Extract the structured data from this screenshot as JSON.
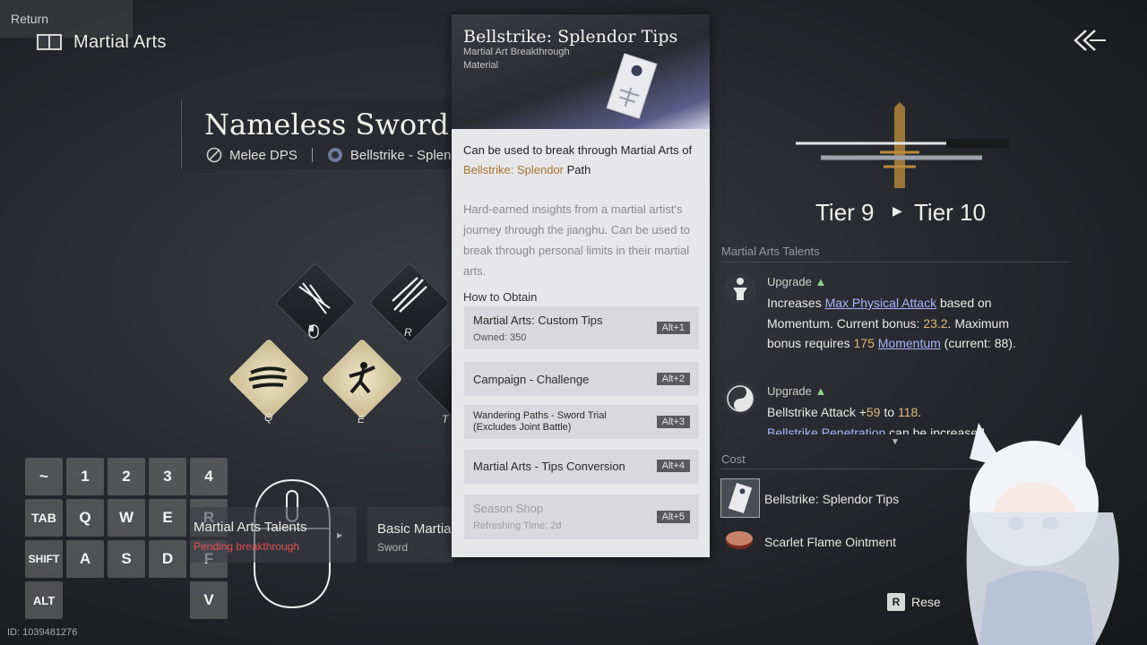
{
  "header": {
    "title": "Martial Arts"
  },
  "character": {
    "name": "Nameless Sword",
    "role": "Melee DPS",
    "path": "Bellstrike - Splendor"
  },
  "skills": {
    "keys": [
      "R",
      "Q",
      "E",
      "T"
    ]
  },
  "keyboard": {
    "row1": [
      "~",
      "1",
      "2",
      "3",
      "4"
    ],
    "row2": [
      "TAB",
      "Q",
      "W",
      "E",
      "R"
    ],
    "row3": [
      "SHIFT",
      "A",
      "S",
      "D",
      "F"
    ],
    "alt": "ALT",
    "return_label": "Return",
    "v": "V"
  },
  "bottom_cards": {
    "talents_title": "Martial Arts Talents",
    "talents_status": "Pending breakthrough",
    "basic_title": "Basic Martial",
    "basic_sub": "Sword"
  },
  "tooltip": {
    "title": "Bellstrike: Splendor Tips",
    "subtitle": "Martial Art Breakthrough Material",
    "desc_pre": "Can be used to break through Martial Arts of ",
    "desc_hl": "Bellstrike: Splendor",
    "desc_post": " Path",
    "lore": "Hard-earned insights from a martial artist's journey through the jianghu. Can be used to break through personal limits in their martial arts.",
    "how_to_obtain": "How to Obtain",
    "sources": [
      {
        "name": "Martial Arts: Custom Tips",
        "meta": "Owned: 350",
        "key": "Alt+1"
      },
      {
        "name": "Campaign - Challenge",
        "meta": "",
        "key": "Alt+2"
      },
      {
        "name": "Wandering Paths - Sword Trial (Excludes Joint Battle)",
        "meta": "",
        "key": "Alt+3"
      },
      {
        "name": "Martial Arts - Tips Conversion",
        "meta": "",
        "key": "Alt+4"
      },
      {
        "name": "Season Shop",
        "meta": "Refreshing Time: 2d",
        "key": "Alt+5"
      }
    ]
  },
  "tier": {
    "from": "Tier 9",
    "to": "Tier 10"
  },
  "talents": {
    "label": "Martial Arts Talents",
    "items": [
      {
        "tag": "Upgrade",
        "p1": "Increases ",
        "link1": "Max Physical Attack",
        "p2": " based on Momentum. Current bonus: ",
        "num1": "23.2",
        "p3": ". Maximum bonus requires ",
        "num2": "175",
        "p4": " ",
        "link2": "Momentum",
        "p5": " (current: 88)."
      },
      {
        "tag": "Upgrade",
        "p1": "Bellstrike Attack +",
        "num1": "59",
        "p2": " to ",
        "num2": "118",
        "p3": ".",
        "link1": "Bellstrike Penetration",
        "p4": " can be increased"
      }
    ]
  },
  "cost": {
    "label": "Cost",
    "items": [
      "Bellstrike: Splendor Tips",
      "Scarlet Flame Ointment"
    ]
  },
  "footer": {
    "reset_key": "R",
    "reset_label": "Rese",
    "id": "ID: 1039481276"
  },
  "colors": {
    "accent_gold": "#a5742e",
    "link": "#a7b5ff",
    "number": "#e0b77a",
    "upgrade": "#8fd08f"
  }
}
